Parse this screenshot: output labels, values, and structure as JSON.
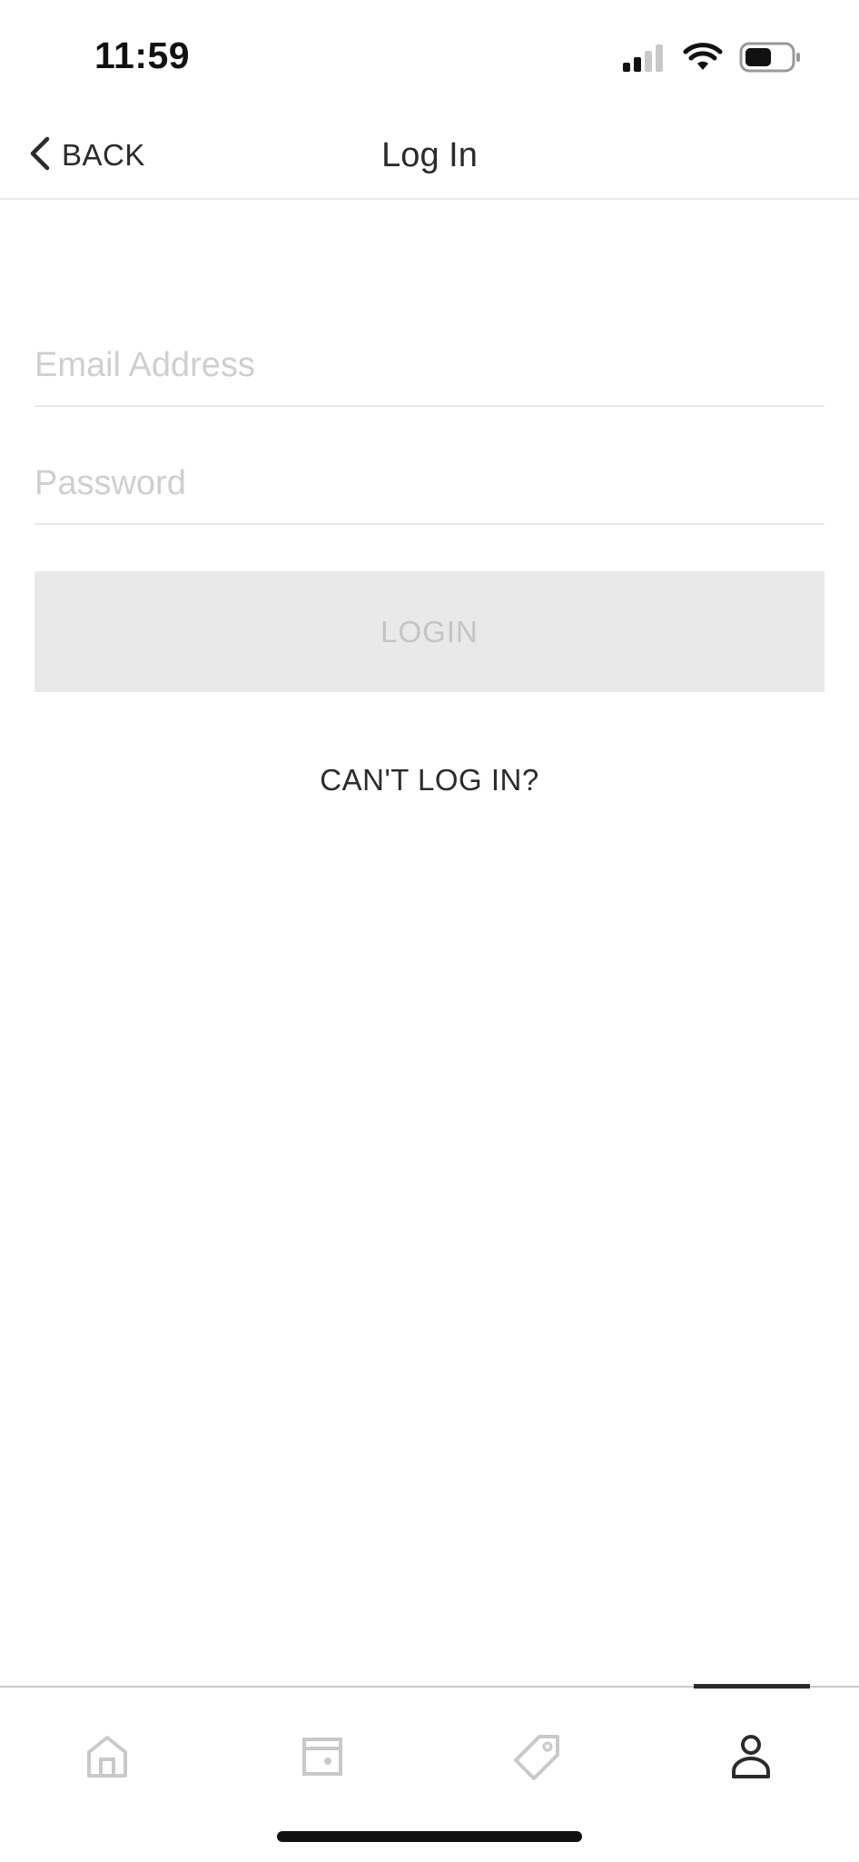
{
  "status_bar": {
    "time": "11:59",
    "icons": [
      "cellular-signal-icon",
      "wifi-icon",
      "battery-icon"
    ]
  },
  "header": {
    "back_label": "BACK",
    "title": "Log In"
  },
  "form": {
    "email": {
      "placeholder": "Email Address",
      "value": ""
    },
    "password": {
      "placeholder": "Password",
      "value": ""
    },
    "login_label": "LOGIN",
    "cant_login_label": "CAN'T LOG IN?"
  },
  "tab_bar": {
    "tabs": [
      {
        "icon": "home-icon",
        "selected": false
      },
      {
        "icon": "storefront-icon",
        "selected": false
      },
      {
        "icon": "tag-icon",
        "selected": false
      },
      {
        "icon": "account-icon",
        "selected": true
      }
    ]
  },
  "colors": {
    "text_primary": "#2b2b2b",
    "placeholder": "#cfcfcf",
    "button_disabled_bg": "#e9e9e9",
    "button_disabled_text": "#c4c4c4",
    "tab_inactive": "#c9c9c9",
    "tab_active": "#2b2b2b"
  }
}
